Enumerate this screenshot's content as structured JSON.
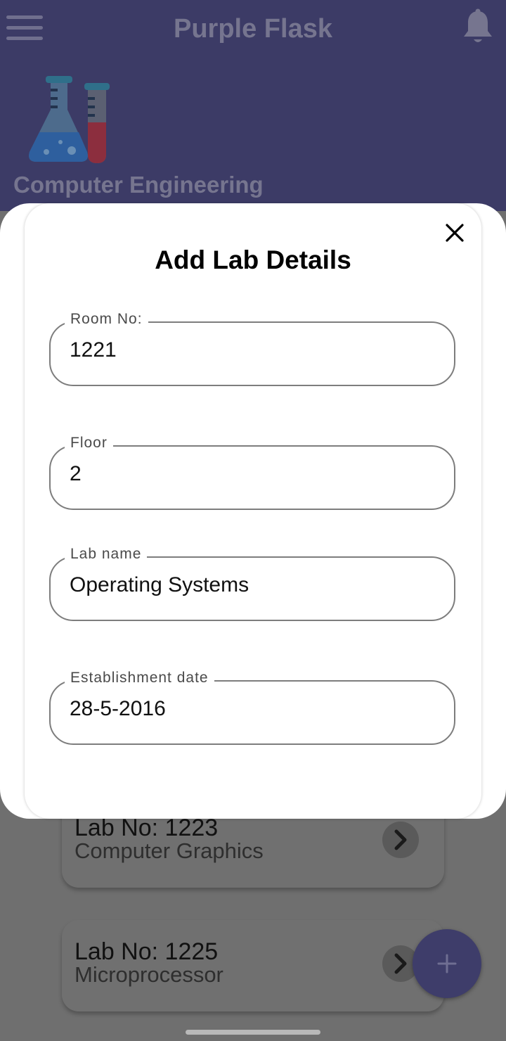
{
  "app": {
    "title": "Purple Flask",
    "department": "Computer Engineering"
  },
  "background_list": [
    {
      "lab_no": "Lab No: 1223",
      "lab_name": "Computer Graphics"
    },
    {
      "lab_no": "Lab No: 1225",
      "lab_name": "Microprocessor"
    }
  ],
  "dialog": {
    "title": "Add Lab Details",
    "fields": [
      {
        "label": "Room No:",
        "value": "1221"
      },
      {
        "label": "Floor",
        "value": "2"
      },
      {
        "label": "Lab name",
        "value": "Operating Systems"
      },
      {
        "label": "Establishment date",
        "value": "28-5-2016"
      }
    ]
  },
  "icons": {
    "menu": "hamburger-menu-icon",
    "notifications": "bell-icon",
    "logo": "flask-logo",
    "close": "close-icon",
    "card_action": "chevron-right-icon",
    "fab": "plus-icon"
  },
  "colors": {
    "header": "#3c3b66",
    "scrim": "#6f6f6f",
    "fab": "#3e3d6a",
    "dialog": "#ffffff"
  }
}
